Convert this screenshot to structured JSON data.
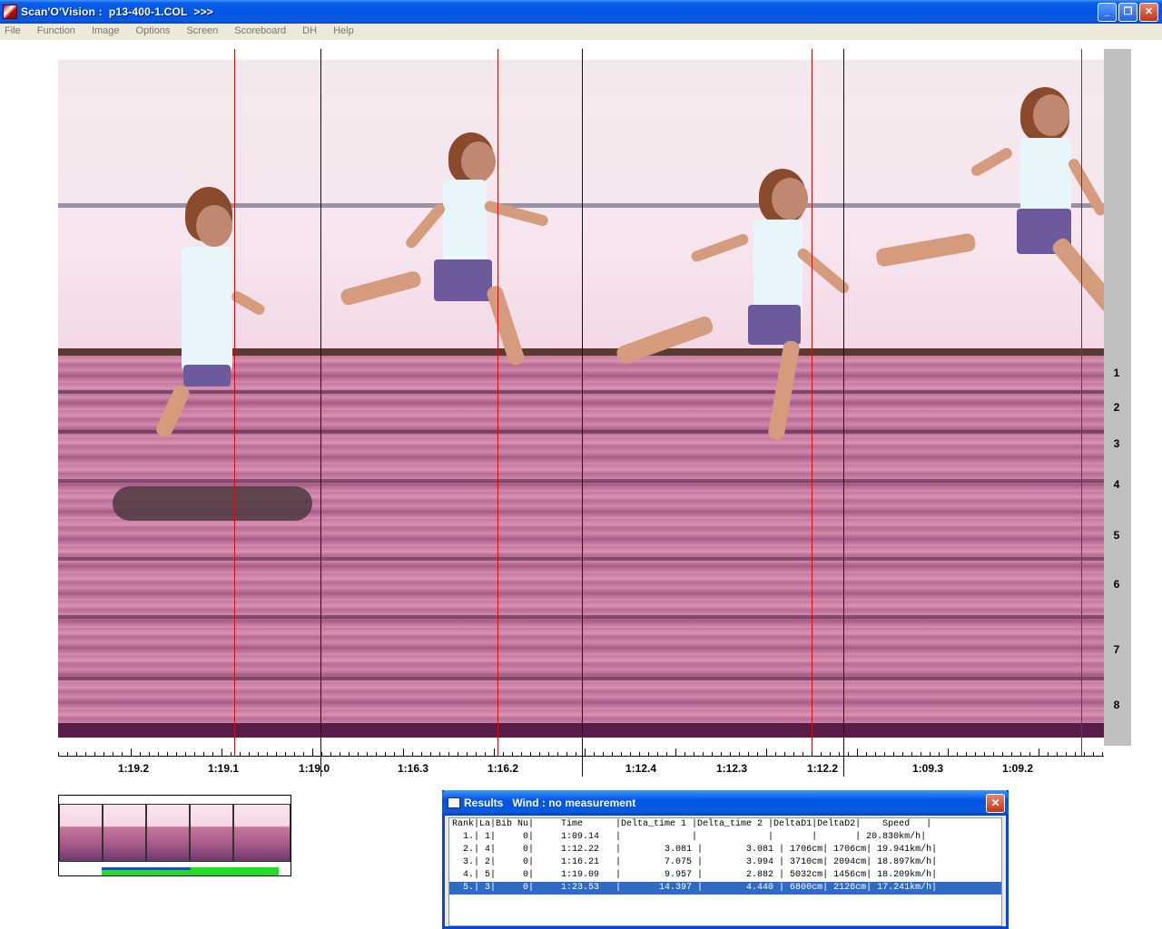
{
  "window": {
    "title": "Scan'O'Vision :  p13-400-1.COL  >>>",
    "minimize": "_",
    "restore": "❐",
    "close": "✕"
  },
  "menu": [
    "File",
    "Function",
    "Image",
    "Options",
    "Screen",
    "Scoreboard",
    "DH",
    "Help"
  ],
  "lanes": [
    "1",
    "2",
    "3",
    "4",
    "5",
    "6",
    "7",
    "8"
  ],
  "time_axis_labels": [
    "1:19.2",
    "1:19.1",
    "1:19.0",
    "1:16.3",
    "1:16.2",
    "1:12.4",
    "1:12.3",
    "1:12.2",
    "1:09.3",
    "1:09.2"
  ],
  "results": {
    "title": "Results   Wind : no measurement",
    "close": "✕",
    "header": "Rank|La|Bib Nu|     Time      |Delta_time 1 |Delta_time 2 |DeltaD1|DeltaD2|    Speed   |",
    "rows": [
      "  1.| 1|     0|     1:09.14   |             |             |       |       | 20.830km/h|",
      "  2.| 4|     0|     1:12.22   |        3.081 |        3.081 | 1706cm| 1706cm| 19.941km/h|",
      "  3.| 2|     0|     1:16.21   |        7.075 |        3.994 | 3710cm| 2094cm| 18.897km/h|",
      "  4.| 5|     0|     1:19.09   |        9.957 |        2.882 | 5032cm| 1456cm| 18.209km/h|",
      "  5.| 3|     0|     1:23.53   |       14.397 |        4.440 | 6800cm| 2126cm| 17.241km/h|"
    ],
    "selected_row": 4
  },
  "colors": {
    "titlebar": "#0054e3",
    "finish_line": "#cc1111",
    "selection": "#316ac5",
    "progress": "#22dd22"
  }
}
